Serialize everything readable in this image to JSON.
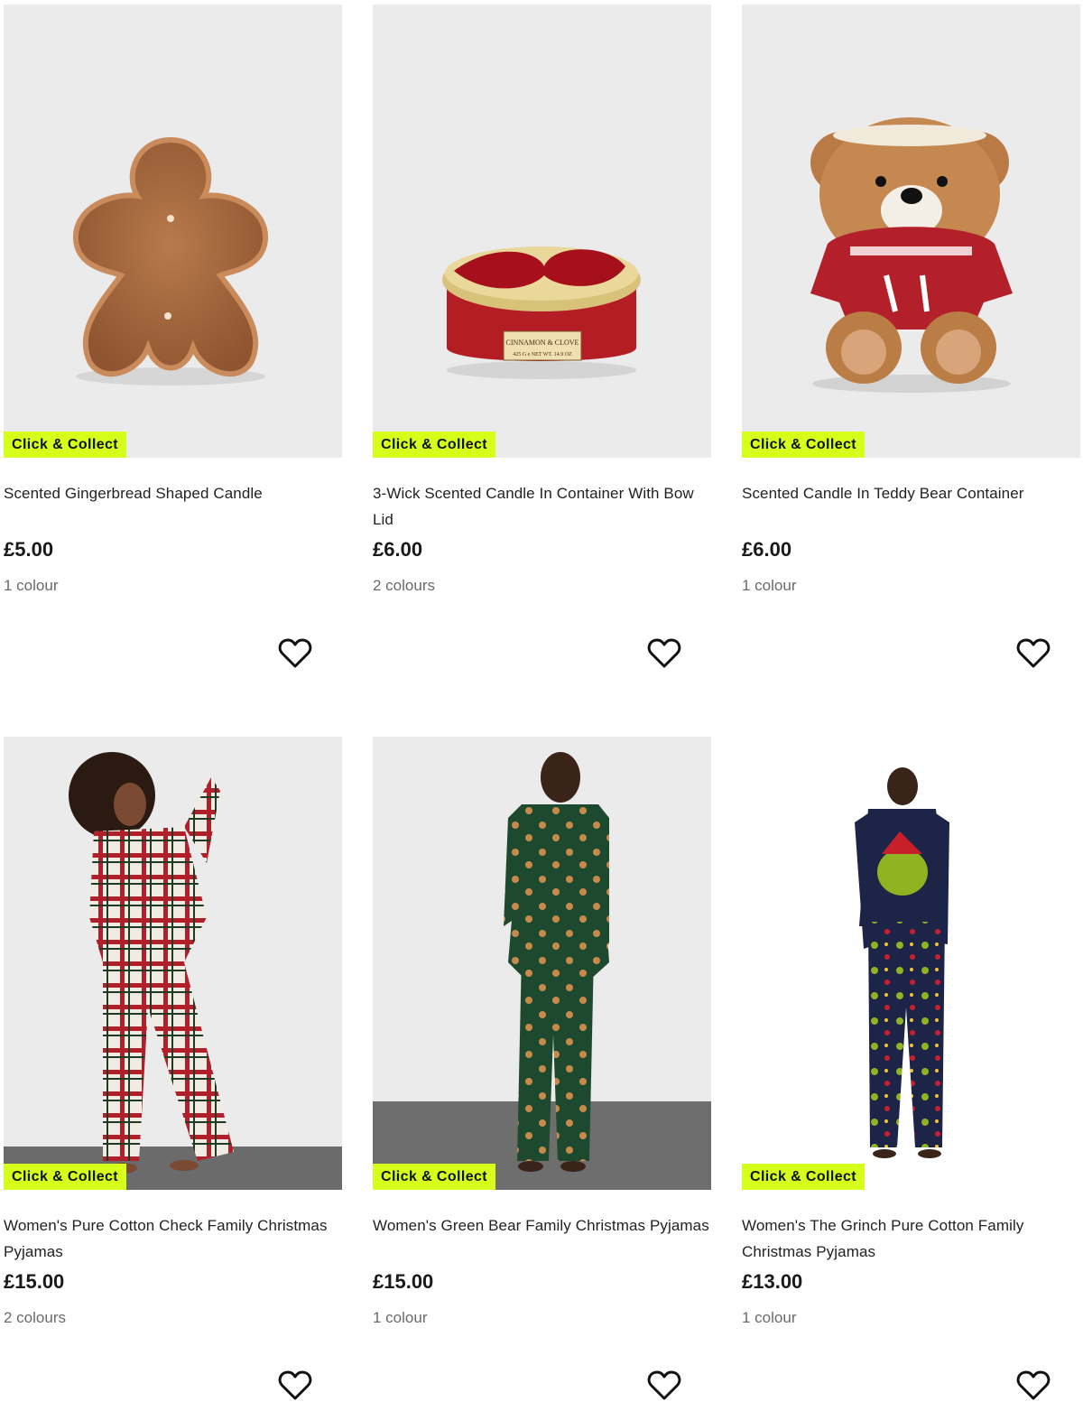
{
  "badge_label": "Click & Collect",
  "accent_color": "#d7ff1c",
  "products": [
    {
      "title": "Scented Gingerbread Shaped Candle",
      "price": "£5.00",
      "colours": "1 colour",
      "image": "gingerbread-candle",
      "wishlist_icon": "heart-outline-icon"
    },
    {
      "title": "3-Wick Scented Candle In Container With Bow Lid",
      "price": "£6.00",
      "colours": "2 colours",
      "image": "red-tin-candle",
      "label_text": [
        "CINNAMON & CLOVE",
        "425 G e NET WT. 14.9 OZ"
      ],
      "wishlist_icon": "heart-outline-icon"
    },
    {
      "title": "Scented Candle In Teddy Bear Container",
      "price": "£6.00",
      "colours": "1 colour",
      "image": "teddy-bear-candle",
      "wishlist_icon": "heart-outline-icon"
    },
    {
      "title": "Women's Pure Cotton Check Family Christmas Pyjamas",
      "price": "£15.00",
      "colours": "2 colours",
      "image": "check-pyjamas-model",
      "wishlist_icon": "heart-outline-icon"
    },
    {
      "title": "Women's Green Bear Family Christmas Pyjamas",
      "price": "£15.00",
      "colours": "1 colour",
      "image": "green-bear-pyjamas-model",
      "wishlist_icon": "heart-outline-icon"
    },
    {
      "title": "Women's The Grinch Pure Cotton Family Christmas Pyjamas",
      "price": "£13.00",
      "colours": "1 colour",
      "image": "grinch-pyjamas-model",
      "wishlist_icon": "heart-outline-icon"
    }
  ]
}
